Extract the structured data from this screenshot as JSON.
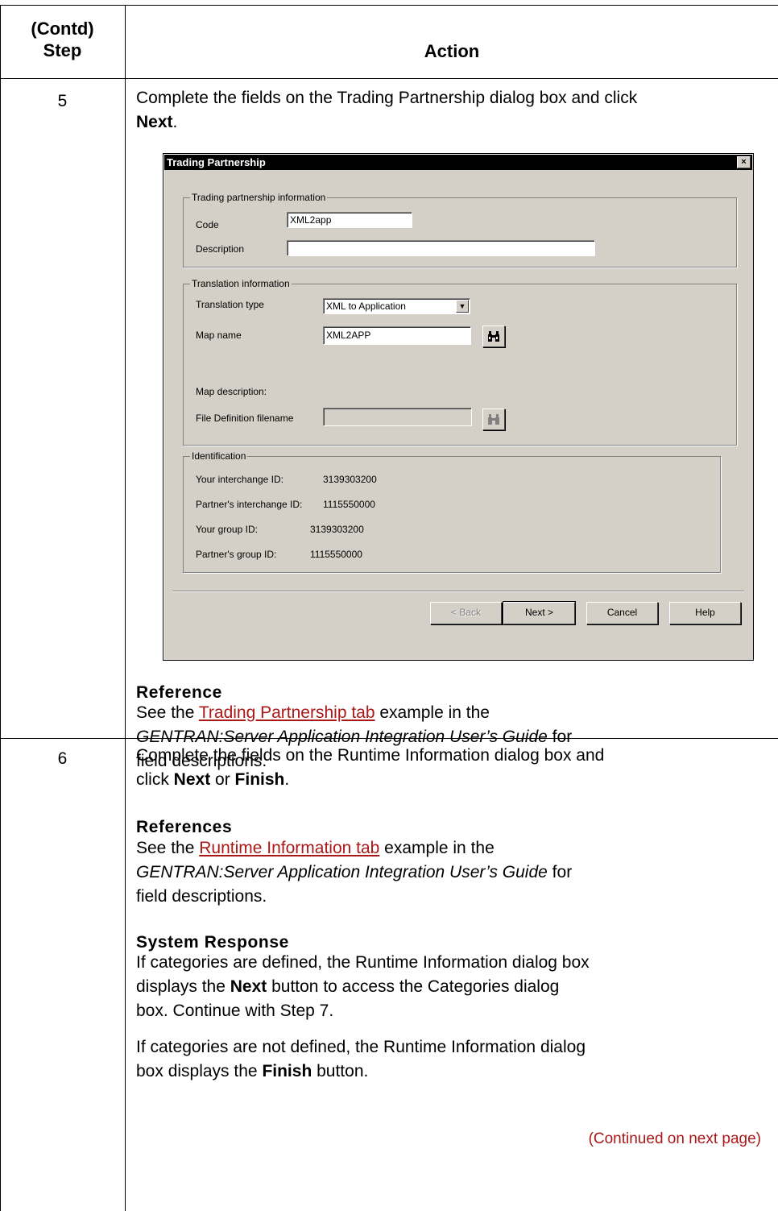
{
  "table": {
    "header_step": "(Contd)\nStep",
    "header_action": "Action"
  },
  "step5": {
    "number": "5",
    "text": "Complete the fields on the Trading Partnership dialog box and click ",
    "next_label": "Next",
    "period": ".",
    "reference_heading": "Reference",
    "ref_prefix": "See the ",
    "ref_link": "Trading Partnership tab",
    "ref_mid": " example in the",
    "ref_italic": "GENTRAN:Server Application Integration User’s Guide",
    "ref_suffix": " for",
    "ref_line3": "field descriptions."
  },
  "dialog": {
    "title": "Trading Partnership",
    "close_glyph": "×",
    "group1": {
      "title": "Trading partnership information",
      "code_label": "Code",
      "code_value": "XML2app",
      "description_label": "Description",
      "description_value": ""
    },
    "group2": {
      "title": "Translation information",
      "translation_type_label": "Translation type",
      "translation_type_value": "XML to Application",
      "map_name_label": "Map name",
      "map_name_value": "XML2APP",
      "map_description_label": "Map description:",
      "file_def_label": "File Definition filename",
      "file_def_value": ""
    },
    "group3": {
      "title": "Identification",
      "your_interchange_label": "Your interchange ID:",
      "your_interchange_value": "3139303200",
      "partner_interchange_label": "Partner's interchange ID:",
      "partner_interchange_value": "1115550000",
      "your_group_label": "Your group ID:",
      "your_group_value": "3139303200",
      "partner_group_label": "Partner's group ID:",
      "partner_group_value": "1115550000"
    },
    "buttons": {
      "back": "< Back",
      "next": "Next >",
      "cancel": "Cancel",
      "help": "Help"
    }
  },
  "step6": {
    "number": "6",
    "line1": "Complete the fields on the Runtime Information dialog box and",
    "line2_prefix": "click ",
    "next_label": "Next",
    "or": " or ",
    "finish_label": "Finish",
    "period": ".",
    "references_heading": "References",
    "ref_prefix": "See the ",
    "ref_link": "Runtime Information tab",
    "ref_mid": " example in the",
    "ref_italic": "GENTRAN:Server Application Integration User’s Guide",
    "ref_suffix": " for",
    "ref_line3": "field descriptions.",
    "system_response_heading": "System Response",
    "sr_line1": "If categories are defined, the Runtime Information dialog box",
    "sr_line2_prefix": "displays the ",
    "sr_next": "Next",
    "sr_line2_suffix": " button to access the Categories dialog",
    "sr_line3": "box. Continue with Step 7.",
    "sr2_line1": "If categories are not defined, the Runtime Information dialog",
    "sr2_line2_prefix": "box displays the ",
    "sr2_finish": "Finish",
    "sr2_line2_suffix": " button.",
    "continued": "(Continued on next page)"
  },
  "colors": {
    "link": "#aa1818",
    "dialog_face": "#d4d0c8",
    "titlebar": "#000000"
  }
}
